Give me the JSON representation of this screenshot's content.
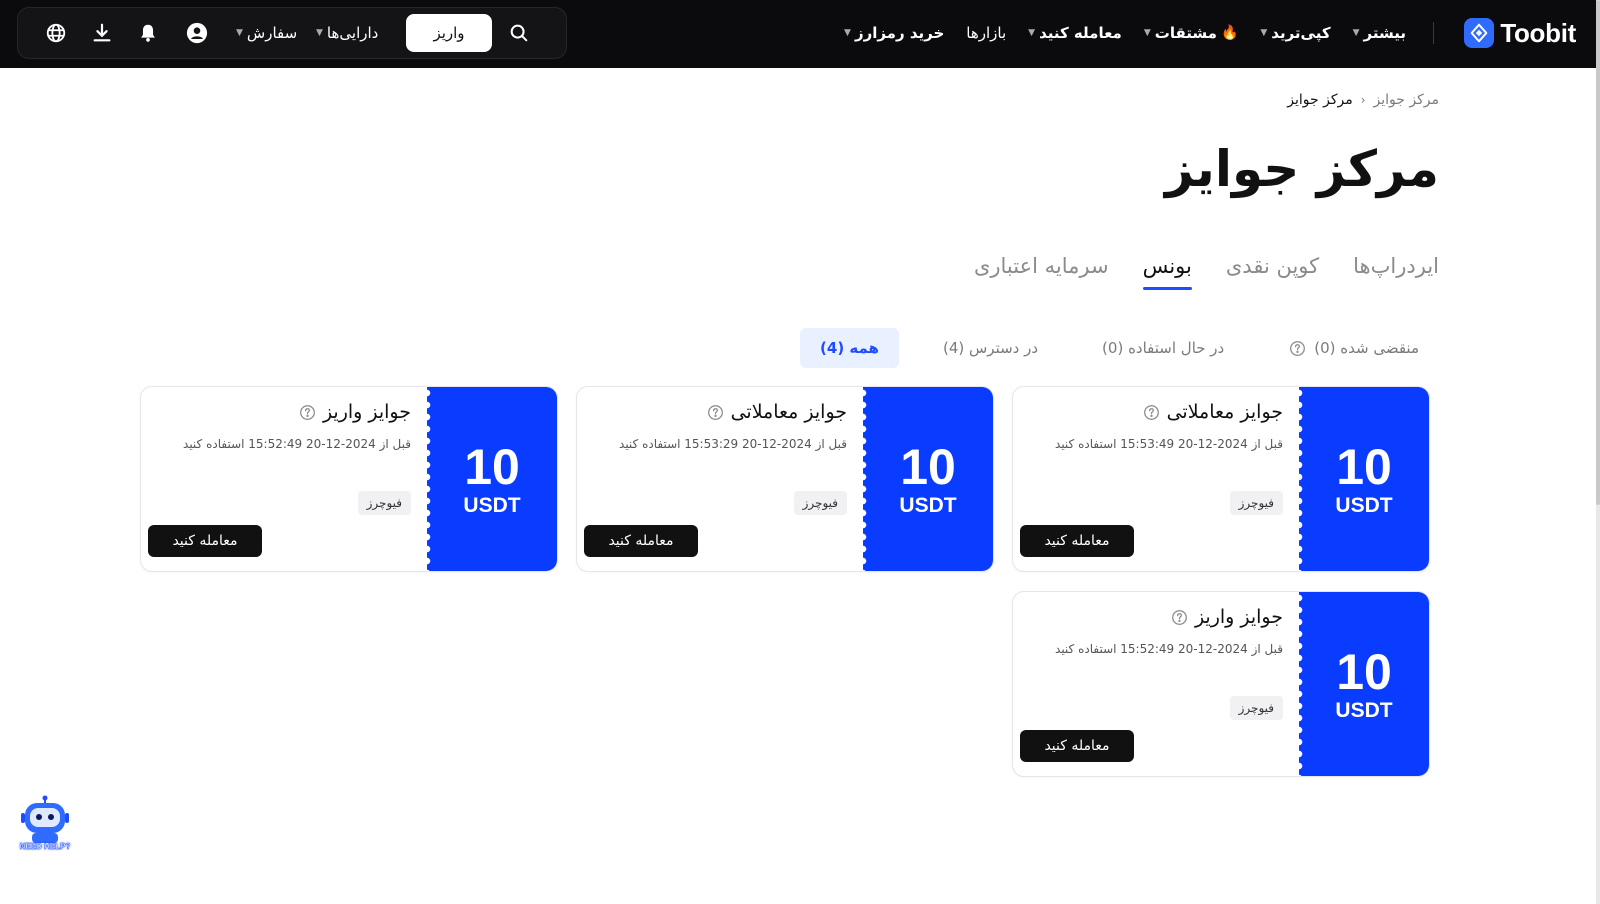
{
  "brand": {
    "name": "Toobit",
    "accent": "#2f6bff"
  },
  "nav": {
    "items": [
      {
        "label": "خرید رمزارز",
        "caret": true,
        "bold": true
      },
      {
        "label": "بازارها",
        "caret": false,
        "bold": false
      },
      {
        "label": "معامله کنید",
        "caret": true,
        "bold": true
      },
      {
        "label": "مشتقات",
        "caret": true,
        "bold": true,
        "icon": "fire-icon"
      },
      {
        "label": "کپی‌ترید",
        "caret": true,
        "bold": true
      },
      {
        "label": "بیشتر",
        "caret": true,
        "bold": true
      }
    ],
    "actions": {
      "deposit_label": "واریز",
      "assets_label": "دارایی‌ها",
      "orders_label": "سفارش",
      "icons": [
        "search-icon",
        "user-icon",
        "bell-icon",
        "download-icon",
        "globe-icon"
      ]
    }
  },
  "breadcrumb": {
    "parent": "مرکز جوایز",
    "current": "مرکز جوایز",
    "separator": "‹"
  },
  "page": {
    "title": "مرکز جوایز"
  },
  "tabs": [
    {
      "label": "سرمایه اعتباری",
      "active": false
    },
    {
      "label": "بونس",
      "active": true
    },
    {
      "label": "کوپن نقدی",
      "active": false
    },
    {
      "label": "ایردراپ‌ها",
      "active": false
    }
  ],
  "filters": [
    {
      "label": "همه (4)",
      "active": true
    },
    {
      "label": "در دسترس (4)",
      "active": false
    },
    {
      "label": "در حال استفاده (0)",
      "active": false
    },
    {
      "label": "منقضی شده (0)",
      "active": false,
      "help": true
    }
  ],
  "cards": [
    {
      "title": "جوایز معاملاتی",
      "expiry": "قبل از 2024-12-20 15:53:49 استفاده کنید",
      "tag": "فیوچرز",
      "amount": "10",
      "currency": "USDT",
      "button": "معامله کنید"
    },
    {
      "title": "جوایز معاملاتی",
      "expiry": "قبل از 2024-12-20 15:53:29 استفاده کنید",
      "tag": "فیوچرز",
      "amount": "10",
      "currency": "USDT",
      "button": "معامله کنید"
    },
    {
      "title": "جوایز واریز",
      "expiry": "قبل از 2024-12-20 15:52:49 استفاده کنید",
      "tag": "فیوچرز",
      "amount": "10",
      "currency": "USDT",
      "button": "معامله کنید"
    },
    {
      "title": "جوایز واریز",
      "expiry": "قبل از 2024-12-20 15:52:49 استفاده کنید",
      "tag": "فیوچرز",
      "amount": "10",
      "currency": "USDT",
      "button": "معامله کنید"
    }
  ],
  "helpbot": {
    "label": "NEED HELP?"
  },
  "colors": {
    "card_stub": "#0a3cff",
    "active_tab_underline": "#1f4cff",
    "active_filter_bg": "#e9f0ff",
    "active_filter_text": "#1f4cff",
    "navbar_bg": "#0b0b0d"
  }
}
